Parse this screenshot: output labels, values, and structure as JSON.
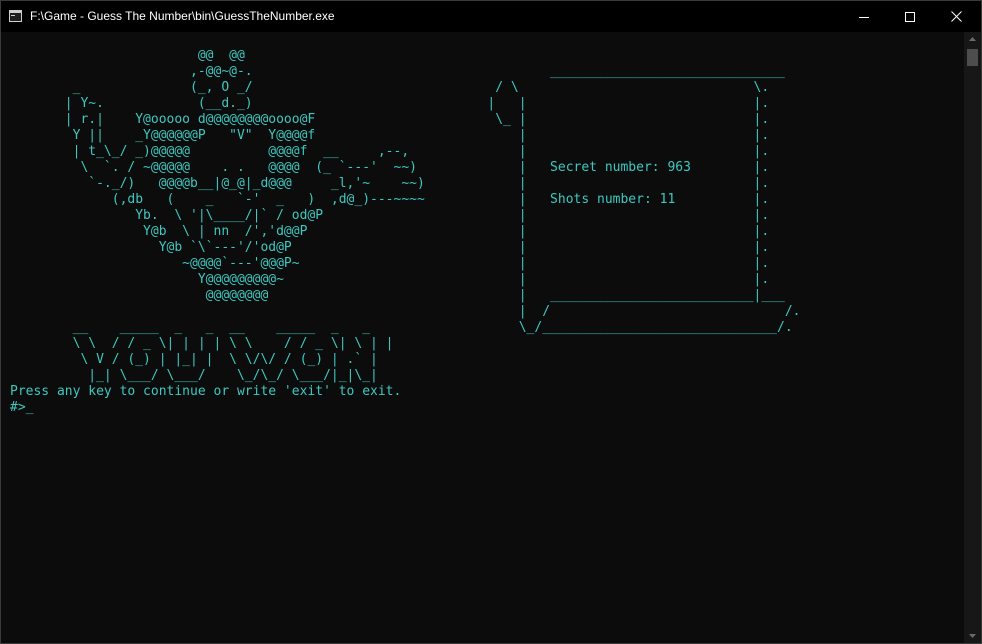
{
  "window": {
    "title": "F:\\Game - Guess The Number\\bin\\GuessTheNumber.exe"
  },
  "console": {
    "art": "                        @@  @@\n                       ,-@@~@-.                                      ______________________________\n        _              (_, O _/                               / \\                              \\.\n       | Y~.            (__d._)                              |   |                             |.\n       | r.|    Y@ooooo d@@@@@@@@oooo@F                       \\_ |                             |.\n        Y ||    _Y@@@@@@P   \"V\"  Y@@@@f                          |                             |.\n        | t_\\_/ _)@@@@@          @@@@f  __     ,--,              |                             |.\n         \\  `. / ~@@@@@    . .   @@@@  (_ `---'  ~~)             |   Secret number: 963        |.\n          `-._/)   @@@@b__|@_@|_d@@@     _l,'~    ~~)            |                             |.\n             (,db   (    _   `-'  _   )  ,d@_)---~~~~            |   Shots number: 11          |.\n                Yb.  \\ '|\\____/|` / od@P                         |                             |.\n                 Y@b  \\ | nn  /','d@@P                           |                             |.\n                   Y@b `\\`---'/'od@P                             |                             |.\n                      ~@@@@`---'@@@P~                            |                             |.\n                        Y@@@@@@@@@~                              |                             |.\n                         @@@@@@@@                                |   __________________________|___\n                                                                 |  /                              /.\n        __    _____  _   _  __    _____  _   _                   \\_/______________________________/.\n        \\ \\  / / _ \\| | | | \\ \\    / / _ \\| \\ | |\n         \\ V / (_) | |_| |  \\ \\/\\/ / (_) | .` |\n          |_| \\___/ \\___/    \\_/\\_/ \\___/|_|\\_|",
    "prompt": "Press any key to continue or write 'exit' to exit.",
    "input_prefix": "#>",
    "cursor": "_"
  },
  "game": {
    "secret_label": "Secret number:",
    "secret_value": "963",
    "shots_label": "Shots number:",
    "shots_value": "11"
  },
  "colors": {
    "console_text": "#3dc8c0",
    "console_bg": "#0c0c0c",
    "titlebar_bg": "#000000"
  },
  "icons": {
    "app": "console-app-icon",
    "minimize": "minimize-icon",
    "maximize": "maximize-icon",
    "close": "close-icon"
  }
}
